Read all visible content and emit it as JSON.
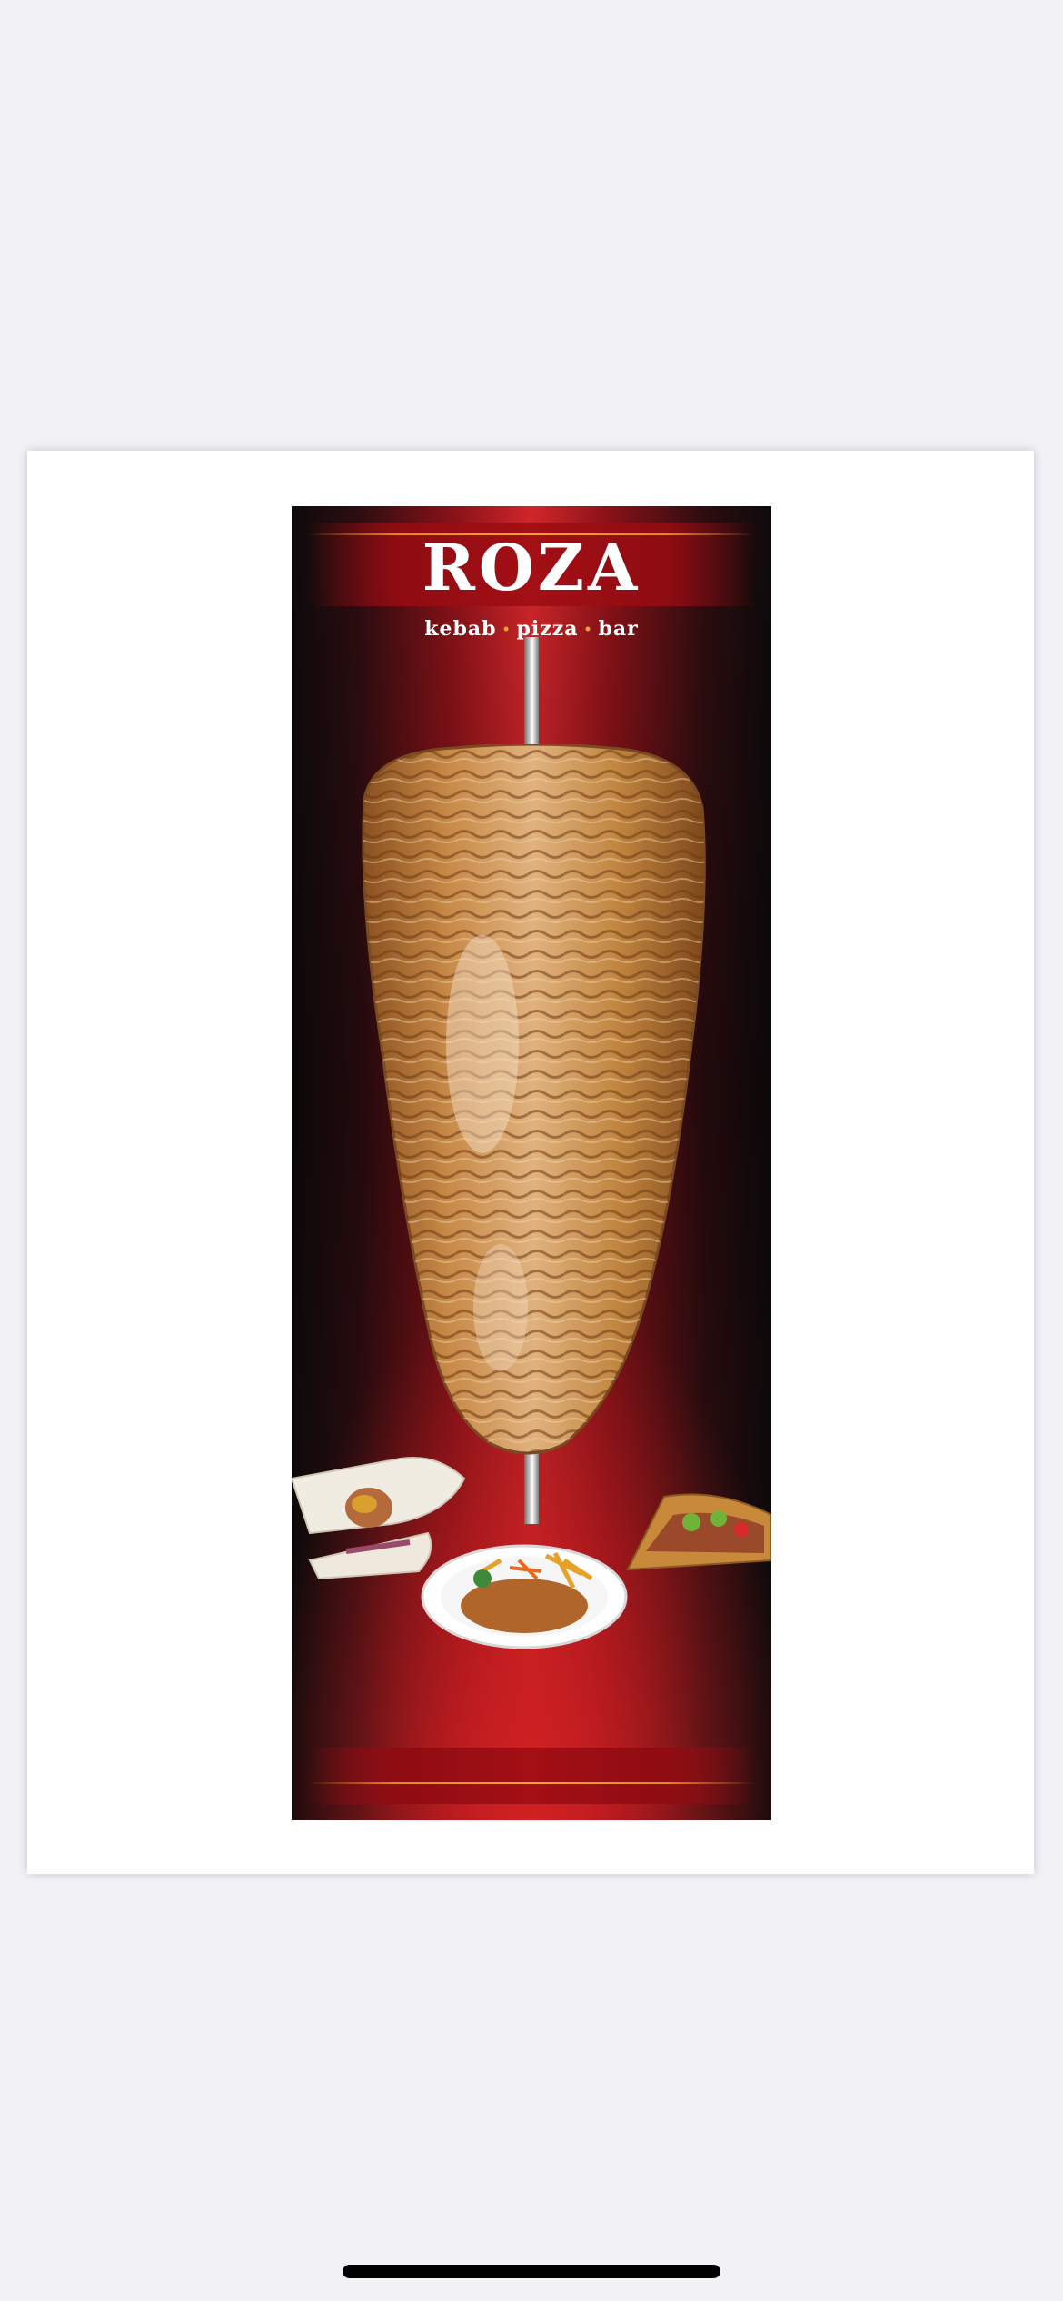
{
  "poster": {
    "title": "ROZA",
    "tagline": {
      "word1": "kebab",
      "word2": "pizza",
      "word3": "bar",
      "separator": "•"
    }
  },
  "icons": {
    "kebab": "doner-kebab-image",
    "wraps": "wrap-sandwich-image",
    "plate": "kebab-plate-image",
    "pizza": "pizza-slice-image"
  },
  "colors": {
    "page_background": "#f1f1f6",
    "poster_red": "#d1262a",
    "poster_dark": "#0e0a0b",
    "accent_gold": "#f0a232",
    "title_white": "#ffffff"
  }
}
